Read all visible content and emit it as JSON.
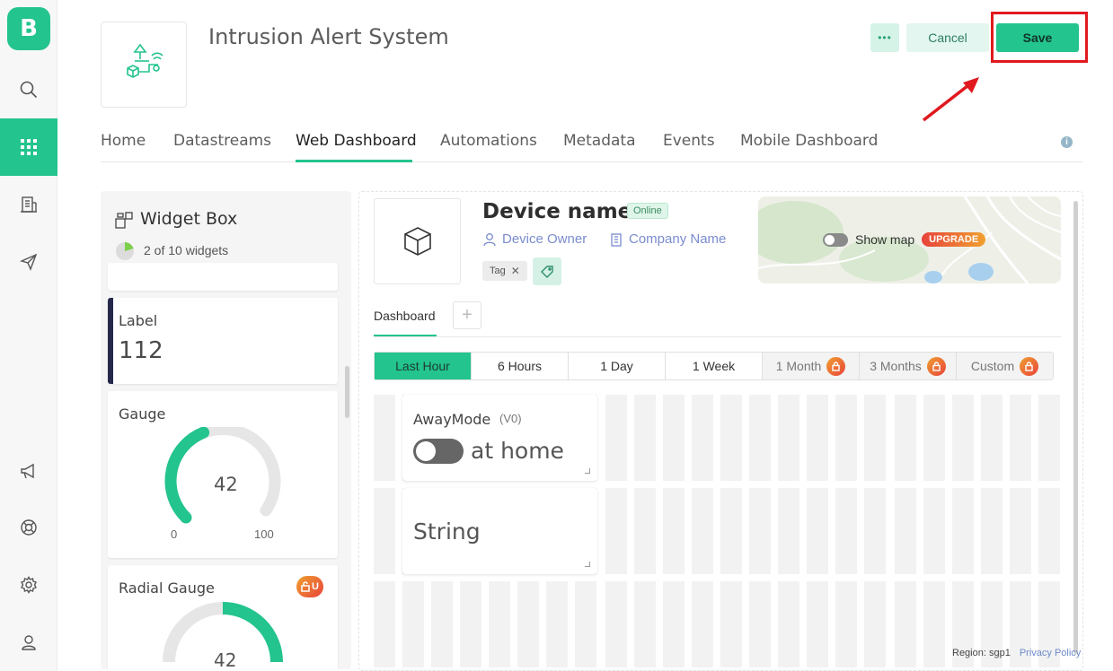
{
  "app": {
    "logo_letter": "B",
    "title": "Intrusion Alert System"
  },
  "rail": {
    "icons": [
      "search-icon",
      "apps-grid-icon",
      "building-icon",
      "send-icon",
      "megaphone-icon",
      "help-lifebuoy-icon",
      "gear-icon",
      "user-icon"
    ]
  },
  "header": {
    "more_label": "•••",
    "cancel_label": "Cancel",
    "save_label": "Save"
  },
  "tabs": [
    "Home",
    "Datastreams",
    "Web Dashboard",
    "Automations",
    "Metadata",
    "Events",
    "Mobile Dashboard"
  ],
  "widget_box": {
    "title": "Widget Box",
    "count": "2 of 10 widgets",
    "widgets": [
      {
        "name": "Label",
        "value": "112"
      },
      {
        "name": "Gauge",
        "value": "42",
        "min": "0",
        "max": "100",
        "level": 0.42
      },
      {
        "name": "Radial Gauge",
        "value": "42",
        "level": 0.7
      }
    ],
    "locked_badge": "U"
  },
  "device": {
    "name": "Device name",
    "status": "Online",
    "owner": "Device Owner",
    "company": "Company Name",
    "tag": "Tag",
    "show_map": "Show map",
    "upgrade": "UPGRADE"
  },
  "dashboard": {
    "tab": "Dashboard",
    "add": "+",
    "ranges": [
      {
        "label": "Last Hour",
        "state": "active"
      },
      {
        "label": "6 Hours",
        "state": "normal"
      },
      {
        "label": "1 Day",
        "state": "normal"
      },
      {
        "label": "1 Week",
        "state": "normal"
      },
      {
        "label": "1 Month",
        "state": "locked"
      },
      {
        "label": "3 Months",
        "state": "locked"
      },
      {
        "label": "Custom",
        "state": "locked"
      }
    ],
    "switch_widget": {
      "title": "AwayMode",
      "pin": "(V0)",
      "state_text": "at home"
    },
    "string_widget": {
      "text": "String"
    }
  },
  "footer": {
    "region": "Region: sgp1",
    "privacy": "Privacy Policy"
  },
  "colors": {
    "accent": "#23c48e",
    "highlight": "#e0191f",
    "link": "#7a8ccf"
  }
}
